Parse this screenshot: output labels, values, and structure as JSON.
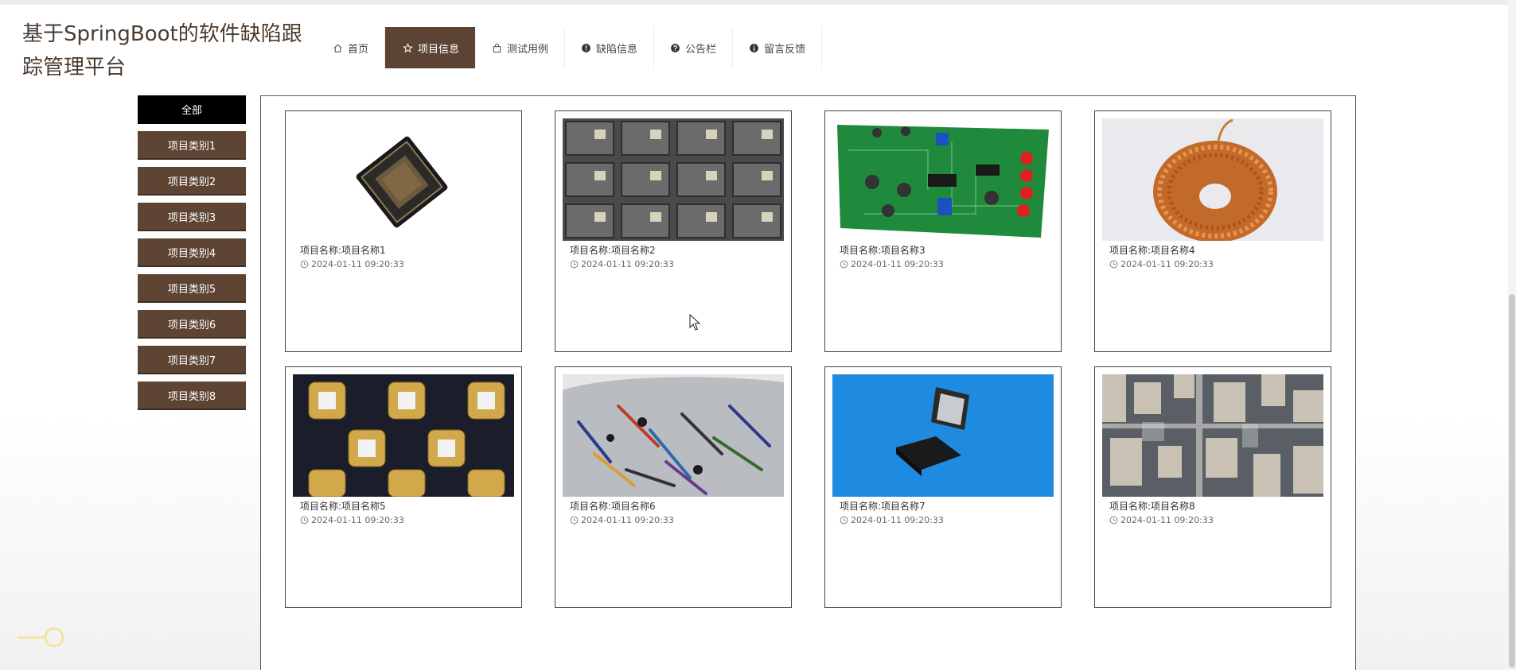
{
  "site": {
    "title": "基于SpringBoot的软件缺陷跟踪管理平台"
  },
  "nav": {
    "items": [
      {
        "label": "首页",
        "icon": "home-icon"
      },
      {
        "label": "项目信息",
        "icon": "star-icon",
        "active": true
      },
      {
        "label": "测试用例",
        "icon": "bag-icon"
      },
      {
        "label": "缺陷信息",
        "icon": "alert-icon"
      },
      {
        "label": "公告栏",
        "icon": "question-icon"
      },
      {
        "label": "留言反馈",
        "icon": "info-icon"
      }
    ]
  },
  "sidebar": {
    "categories": [
      "全部",
      "项目类别1",
      "项目类别2",
      "项目类别3",
      "项目类别4",
      "项目类别5",
      "项目类别6",
      "项目类别7",
      "项目类别8"
    ]
  },
  "projects": [
    {
      "name": "项目名称:项目名称1",
      "time": "2024-01-11 09:20:33",
      "image": "camera-sensor-chip"
    },
    {
      "name": "项目名称:项目名称2",
      "time": "2024-01-11 09:20:33",
      "image": "bga-chip-tray"
    },
    {
      "name": "项目名称:项目名称3",
      "time": "2024-01-11 09:20:33",
      "image": "green-pcb-board"
    },
    {
      "name": "项目名称:项目名称4",
      "time": "2024-01-11 09:20:33",
      "image": "copper-toroid-coil"
    },
    {
      "name": "项目名称:项目名称5",
      "time": "2024-01-11 09:20:33",
      "image": "rf-transistors"
    },
    {
      "name": "项目名称:项目名称6",
      "time": "2024-01-11 09:20:33",
      "image": "components-bag"
    },
    {
      "name": "项目名称:项目名称7",
      "time": "2024-01-11 09:20:33",
      "image": "qfn-chip-blue"
    },
    {
      "name": "项目名称:项目名称8",
      "time": "2024-01-11 09:20:33",
      "image": "city-aerial"
    }
  ],
  "colors": {
    "brand": "#5e4433",
    "active_category": "#000000",
    "text": "#333333"
  }
}
